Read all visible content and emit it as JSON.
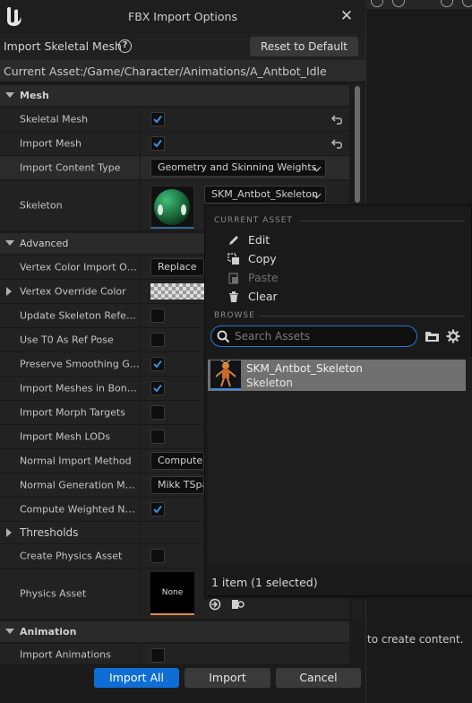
{
  "dialog": {
    "title": "FBX Import Options",
    "import_title": "Import Skeletal Mesh",
    "reset_label": "Reset to Default",
    "current_asset_label": "Current Asset:",
    "current_asset_path": "/Game/Character/Animations/A_Antbot_Idle"
  },
  "sections": {
    "mesh": "Mesh",
    "advanced": "Advanced",
    "thresholds": "Thresholds",
    "animation": "Animation"
  },
  "rows": {
    "skeletal_mesh": "Skeletal Mesh",
    "import_mesh": "Import Mesh",
    "import_content_type": "Import Content Type",
    "skeleton": "Skeleton",
    "vertex_color_import": "Vertex Color Import Option",
    "vertex_override_color": "Vertex Override Color",
    "update_skeleton_ref": "Update Skeleton Reference Pose",
    "use_t0": "Use T0 As Ref Pose",
    "preserve_smoothing": "Preserve Smoothing Groups",
    "import_meshes_bone": "Import Meshes in Bone Hierarchy",
    "import_morph": "Import Morph Targets",
    "import_lods": "Import Mesh LODs",
    "normal_import": "Normal Import Method",
    "normal_generation": "Normal Generation Method",
    "compute_weighted": "Compute Weighted Normals",
    "create_physics": "Create Physics Asset",
    "physics_asset": "Physics Asset",
    "import_animations": "Import Animations"
  },
  "values": {
    "import_content_type": "Geometry and Skinning Weights.",
    "skeleton": "SKM_Antbot_Skeleton",
    "vertex_color_import": "Replace",
    "normal_import": "Compute Normals",
    "normal_generation": "Mikk TSpace",
    "physics_none": "None"
  },
  "checkboxes": {
    "skeletal_mesh": true,
    "import_mesh": true,
    "update_skeleton_ref": false,
    "use_t0": false,
    "preserve_smoothing": true,
    "import_meshes_bone": true,
    "import_morph": false,
    "import_lods": false,
    "compute_weighted": true,
    "create_physics": false,
    "import_animations": false
  },
  "footer": {
    "import_all": "Import All",
    "import": "Import",
    "cancel": "Cancel"
  },
  "picker": {
    "current_asset_header": "CURRENT ASSET",
    "edit": "Edit",
    "copy": "Copy",
    "paste": "Paste",
    "clear": "Clear",
    "browse_header": "BROWSE",
    "search_placeholder": "Search Assets",
    "result_name": "SKM_Antbot_Skeleton",
    "result_type": "Skeleton",
    "status": "1 item (1 selected)"
  },
  "backdrop": {
    "hint": "to create content."
  },
  "colors": {
    "accent": "#0f6dd6",
    "check": "#3a8fe0"
  }
}
